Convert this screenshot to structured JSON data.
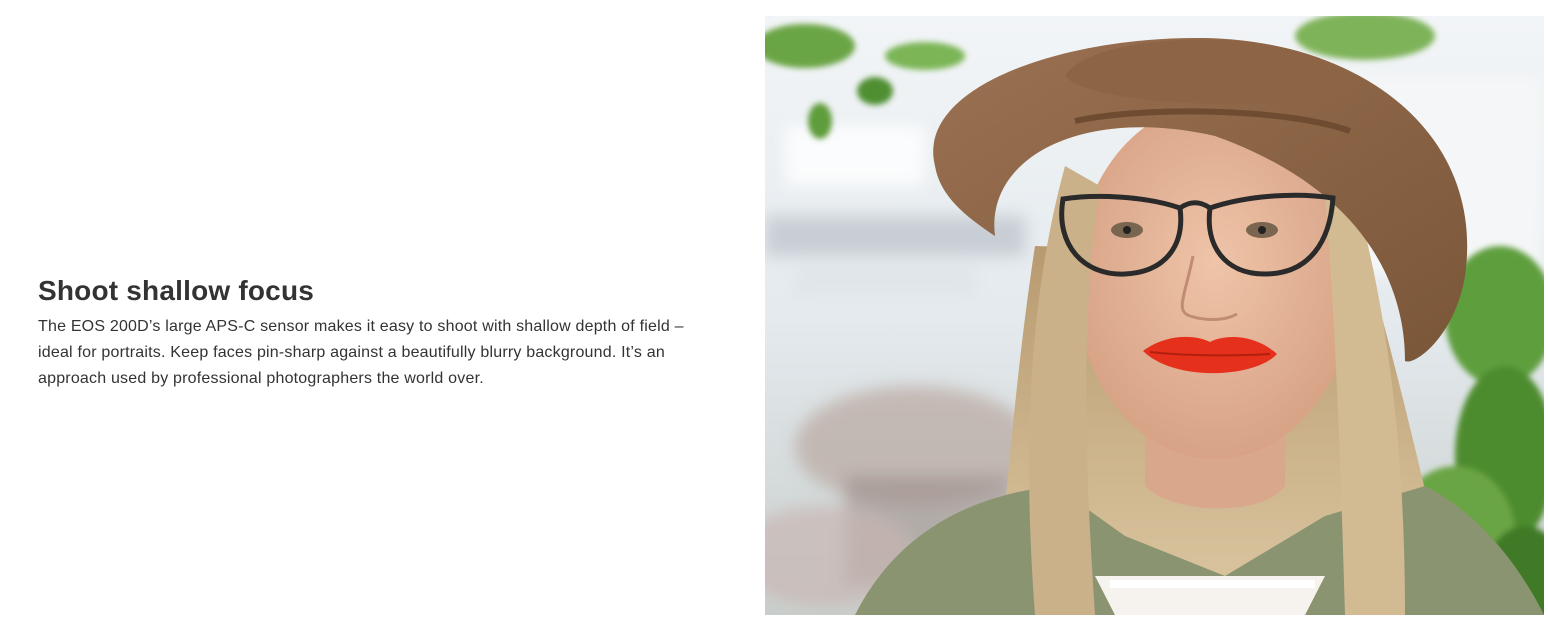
{
  "section": {
    "title": "Shoot shallow focus",
    "body": "The EOS 200D’s large APS-C sensor makes it easy to shoot with shallow depth of field – ideal for portraits. Keep faces pin-sharp against a beautifully blurry background. It’s an approach used by professional photographers the world over."
  },
  "photo": {
    "subject": "portrait-woman-brown-hat-glasses-red-lips",
    "colors": {
      "hat": "#8a6343",
      "hair": "#cdb58e",
      "skin": "#e4b79b",
      "lips": "#e5301c",
      "jacket": "#8a9470",
      "foliage": "#5f9e3c",
      "background": "#e9eef2"
    }
  }
}
